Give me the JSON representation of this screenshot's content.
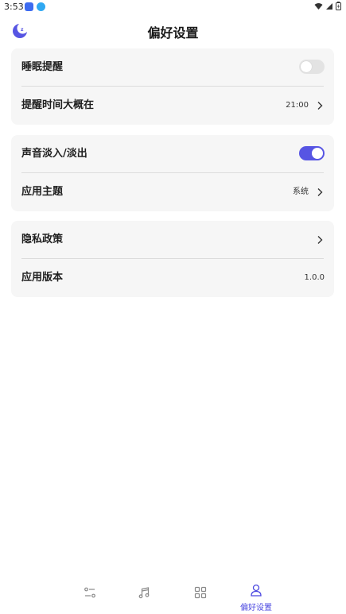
{
  "status_bar": {
    "time": "3:53"
  },
  "header": {
    "title": "偏好设置"
  },
  "sections": {
    "sleep": {
      "items": [
        {
          "label": "睡眠提醒",
          "toggle": "off"
        },
        {
          "label": "提醒时间大概在",
          "value": "21:00"
        }
      ]
    },
    "sound": {
      "items": [
        {
          "label": "声音淡入/淡出",
          "toggle": "on"
        },
        {
          "label": "应用主题",
          "value": "系统"
        }
      ]
    },
    "about": {
      "items": [
        {
          "label": "隐私政策"
        },
        {
          "label": "应用版本",
          "value": "1.0.0"
        }
      ]
    }
  },
  "bottom_nav": {
    "items": [
      {
        "icon": "sliders-icon"
      },
      {
        "icon": "music-note-icon"
      },
      {
        "icon": "grid-icon"
      },
      {
        "icon": "user-icon",
        "label": "偏好设置",
        "active": true
      }
    ]
  },
  "colors": {
    "accent": "#5755e3",
    "card_bg": "#f6f6f6",
    "toggle_off": "#e3e3e3"
  }
}
